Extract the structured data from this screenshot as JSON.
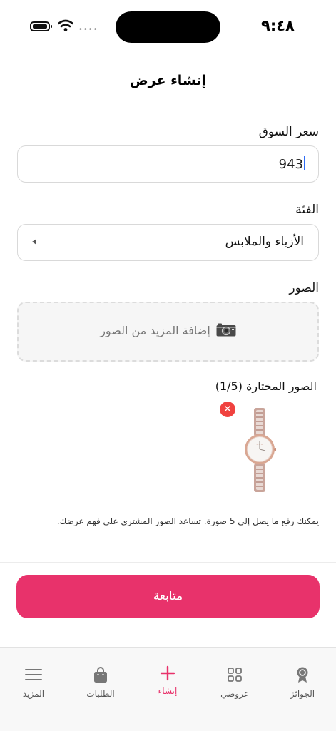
{
  "status_bar": {
    "time": "٩:٤٨"
  },
  "header": {
    "title": "إنشاء عرض"
  },
  "form": {
    "market_price": {
      "label": "سعر السوق",
      "value": "943"
    },
    "category": {
      "label": "الفئة",
      "value": "الأزياء والملابس"
    },
    "photos": {
      "label": "الصور",
      "add_more": "إضافة المزيد من الصور"
    },
    "selected_photos": {
      "label": "الصور المختارة (1/5)",
      "remove_symbol": "✕"
    },
    "hint": "يمكنك رفع ما يصل إلى 5 صورة. تساعد الصور المشتري على فهم عرضك."
  },
  "continue_label": "متابعة",
  "tabbar": {
    "items": [
      {
        "label": "المزيد",
        "icon": "menu-icon"
      },
      {
        "label": "الطلبات",
        "icon": "shopping-bag-icon"
      },
      {
        "label": "إنشاء",
        "icon": "plus-icon",
        "active": true
      },
      {
        "label": "عروضي",
        "icon": "grid-icon"
      },
      {
        "label": "الجوائز",
        "icon": "award-icon"
      }
    ]
  },
  "colors": {
    "accent": "#e8326b",
    "remove": "#f0423f",
    "caret": "#2f6df6"
  }
}
